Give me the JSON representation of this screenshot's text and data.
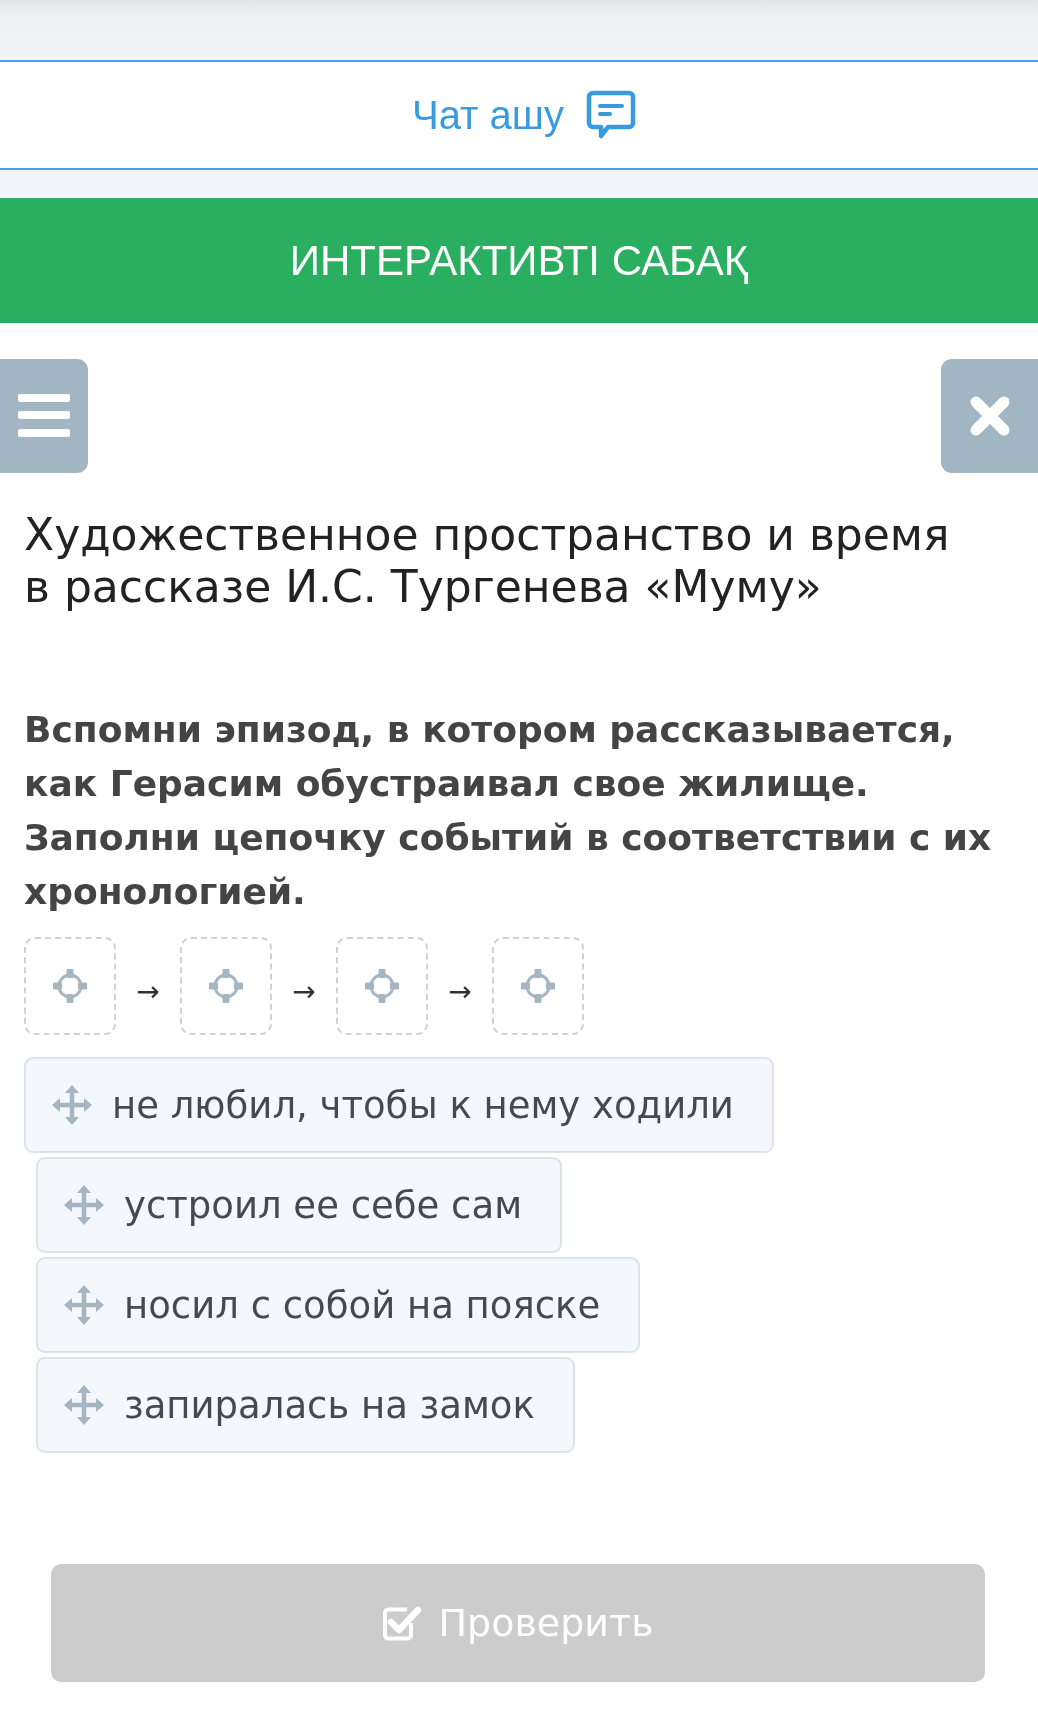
{
  "chat_link": {
    "label": "Чат ашу"
  },
  "banner": {
    "title": "ИНТЕРАКТИВТІ САБАҚ"
  },
  "lesson": {
    "title": "Художественное пространство и время в рассказе И.С. Тургенева «Муму»"
  },
  "task": {
    "question": "Вспомни эпизод, в котором рассказывается, как Герасим обустраивал свое жилище. Заполни цепочку событий в соответствии с их хронологией.",
    "chain": [
      {
        "kind": "slot"
      },
      {
        "kind": "arrow",
        "text": "→"
      },
      {
        "kind": "slot"
      },
      {
        "kind": "arrow",
        "text": "→"
      },
      {
        "kind": "slot"
      },
      {
        "kind": "arrow",
        "text": "→"
      },
      {
        "kind": "slot"
      }
    ],
    "answers": [
      {
        "label": "не любил, чтобы к нему ходили"
      },
      {
        "label": "устроил ее себе сам"
      },
      {
        "label": "носил с собой на пояске"
      },
      {
        "label": "запиралась на замок"
      }
    ]
  },
  "check_button": {
    "label": "Проверить",
    "disabled": true
  }
}
